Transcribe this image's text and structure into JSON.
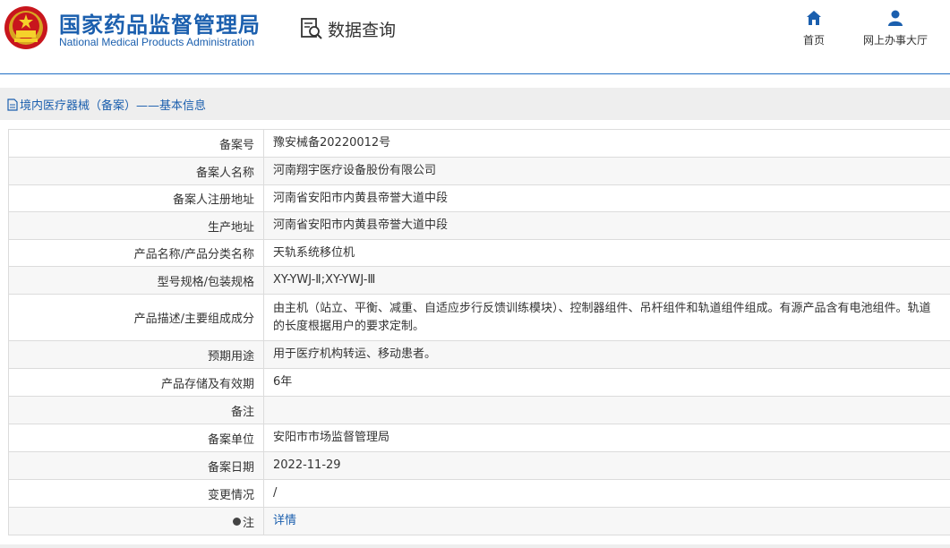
{
  "header": {
    "title_cn": "国家药品监督管理局",
    "title_en": "National Medical Products Administration",
    "query_label": "数据查询",
    "nav": [
      {
        "label": "首页",
        "icon": "home-icon"
      },
      {
        "label": "网上办事大厅",
        "icon": "user-icon"
      }
    ],
    "accent_color": "#1b5fae"
  },
  "breadcrumb": {
    "text": "境内医疗器械（备案）——基本信息"
  },
  "table": {
    "rows": [
      {
        "label": "备案号",
        "value": "豫安械备20220012号"
      },
      {
        "label": "备案人名称",
        "value": "河南翔宇医疗设备股份有限公司"
      },
      {
        "label": "备案人注册地址",
        "value": "河南省安阳市内黄县帝誉大道中段"
      },
      {
        "label": "生产地址",
        "value": "河南省安阳市内黄县帝誉大道中段"
      },
      {
        "label": "产品名称/产品分类名称",
        "value": "天轨系统移位机"
      },
      {
        "label": "型号规格/包装规格",
        "value": "XY-YWJ-Ⅱ;XY-YWJ-Ⅲ"
      },
      {
        "label": "产品描述/主要组成成分",
        "value": "由主机（站立、平衡、减重、自适应步行反馈训练模块）、控制器组件、吊杆组件和轨道组件组成。有源产品含有电池组件。轨道的长度根据用户的要求定制。"
      },
      {
        "label": "预期用途",
        "value": "用于医疗机构转运、移动患者。"
      },
      {
        "label": "产品存储及有效期",
        "value": "6年"
      },
      {
        "label": "备注",
        "value": ""
      },
      {
        "label": "备案单位",
        "value": "安阳市市场监督管理局"
      },
      {
        "label": "备案日期",
        "value": "2022-11-29"
      },
      {
        "label": "变更情况",
        "value": "/"
      },
      {
        "label": "注",
        "value": "详情"
      }
    ]
  }
}
